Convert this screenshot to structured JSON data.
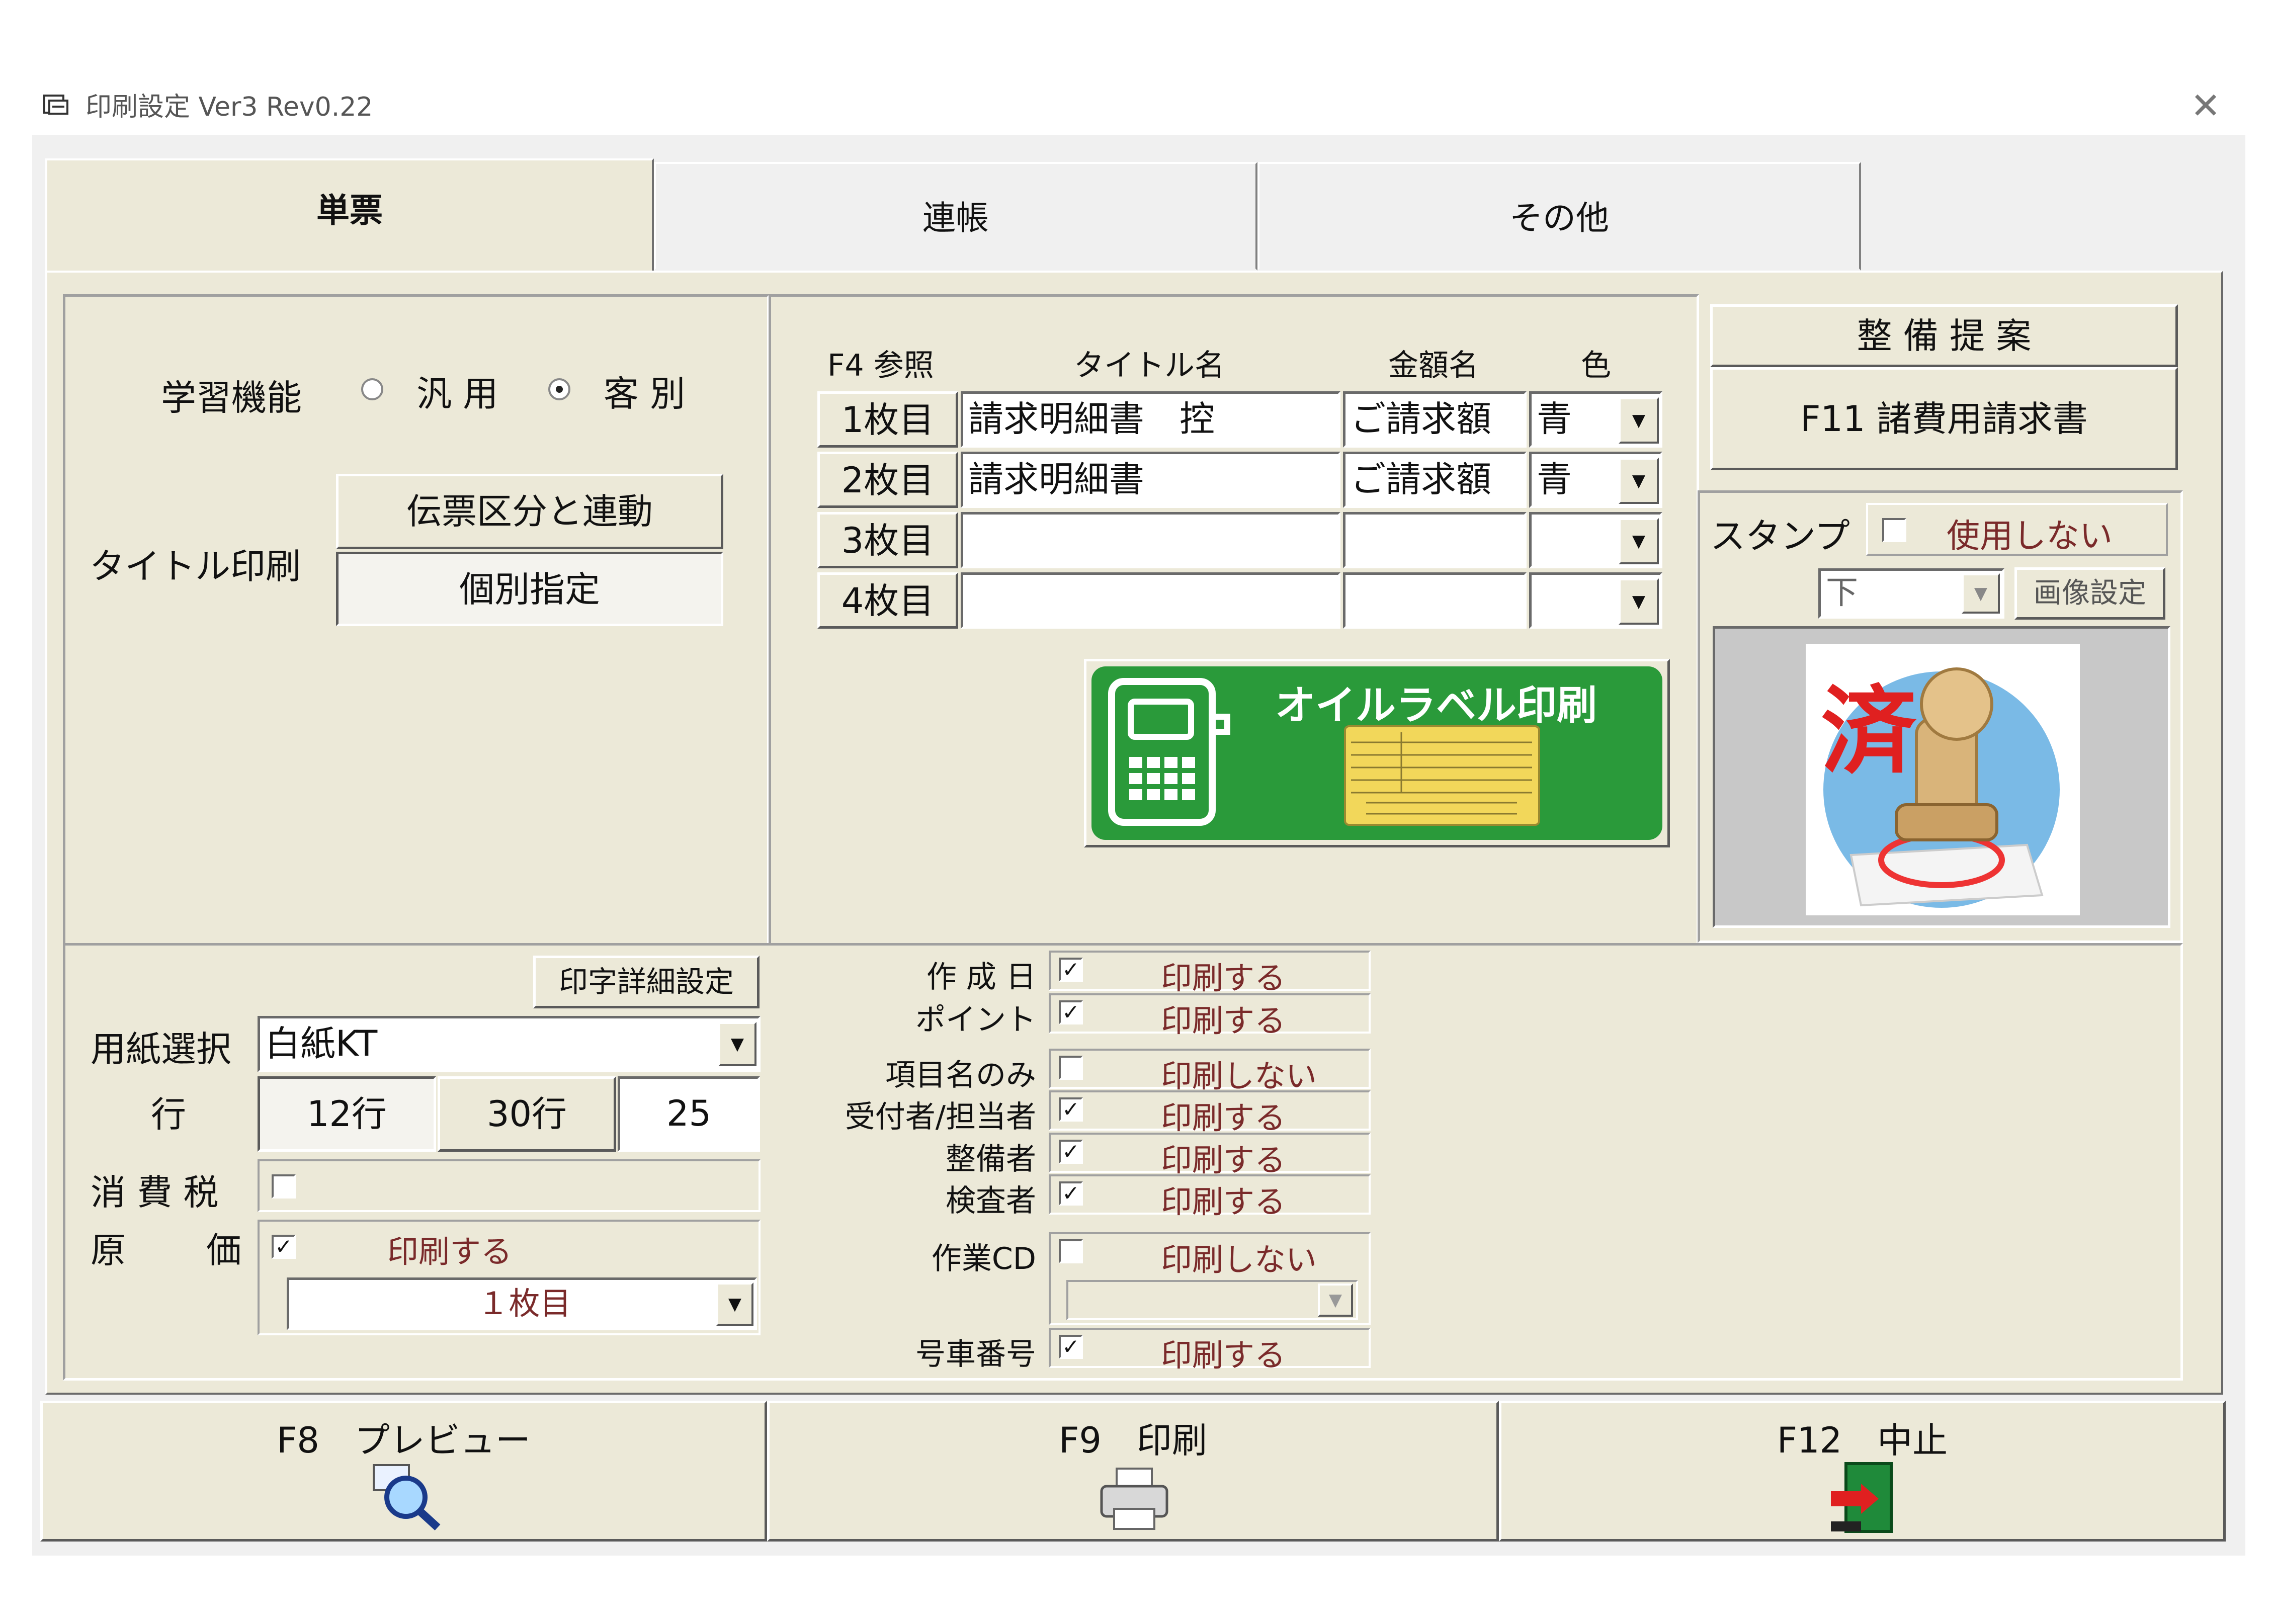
{
  "window": {
    "title": "印刷設定 Ver3 Rev0.22",
    "close_glyph": "✕"
  },
  "tabs": [
    {
      "label": "単票"
    },
    {
      "label": "連帳"
    },
    {
      "label": "その他"
    }
  ],
  "learning": {
    "label": "学習機能",
    "option_general": "汎 用",
    "option_customer": "客 別",
    "selected": "客 別"
  },
  "title_print": {
    "label": "タイトル印刷",
    "btn_link": "伝票区分と連動",
    "btn_individual": "個別指定"
  },
  "sheets": {
    "headers": {
      "ref": "F4 参照",
      "title": "タイトル名",
      "amount": "金額名",
      "color": "色"
    },
    "rows": [
      {
        "label": "1枚目",
        "title": "請求明細書　控",
        "amount": "ご請求額",
        "color": "青"
      },
      {
        "label": "2枚目",
        "title": "請求明細書",
        "amount": "ご請求額",
        "color": "青"
      },
      {
        "label": "3枚目",
        "title": "",
        "amount": "",
        "color": ""
      },
      {
        "label": "4枚目",
        "title": "",
        "amount": "",
        "color": ""
      }
    ],
    "combo_arrow": "▼"
  },
  "oil_label": {
    "text": "オイルラベル印刷",
    "bg_color": "#2a9a3a"
  },
  "right_buttons": {
    "maintenance": "整 備 提 案",
    "f11": "F11  諸費用請求書"
  },
  "stamp": {
    "label": "スタンプ",
    "use_text": "使用しない",
    "use_checked": false,
    "position": "下",
    "image_btn": "画像設定",
    "stamp_char": "済"
  },
  "paper": {
    "detail_btn": "印字詳細設定",
    "select_label": "用紙選択",
    "select_value": "白紙KT",
    "lines_label": "行",
    "lines_12": "12行",
    "lines_30": "30行",
    "lines_value": "25",
    "tax_label": "消 費 税",
    "cost_label_1": "原",
    "cost_label_2": "価",
    "cost_print": "印刷する",
    "cost_sheet": "１枚目"
  },
  "print_items": [
    {
      "label": "作 成 日",
      "checked": true,
      "value": "印刷する"
    },
    {
      "label": "ポイント",
      "checked": true,
      "value": "印刷する"
    },
    {
      "label": "項目名のみ",
      "checked": false,
      "value": "印刷しない"
    },
    {
      "label": "受付者/担当者",
      "checked": true,
      "value": "印刷する"
    },
    {
      "label": "整備者",
      "checked": true,
      "value": "印刷する"
    },
    {
      "label": "検査者",
      "checked": true,
      "value": "印刷する"
    },
    {
      "label": "作業CD",
      "checked": false,
      "value": "印刷しない"
    },
    {
      "label": "号車番号",
      "checked": true,
      "value": "印刷する"
    }
  ],
  "footer": {
    "preview": "F8　プレビュー",
    "print": "F9　印刷",
    "cancel": "F12　中止"
  },
  "check_glyph": "✓"
}
